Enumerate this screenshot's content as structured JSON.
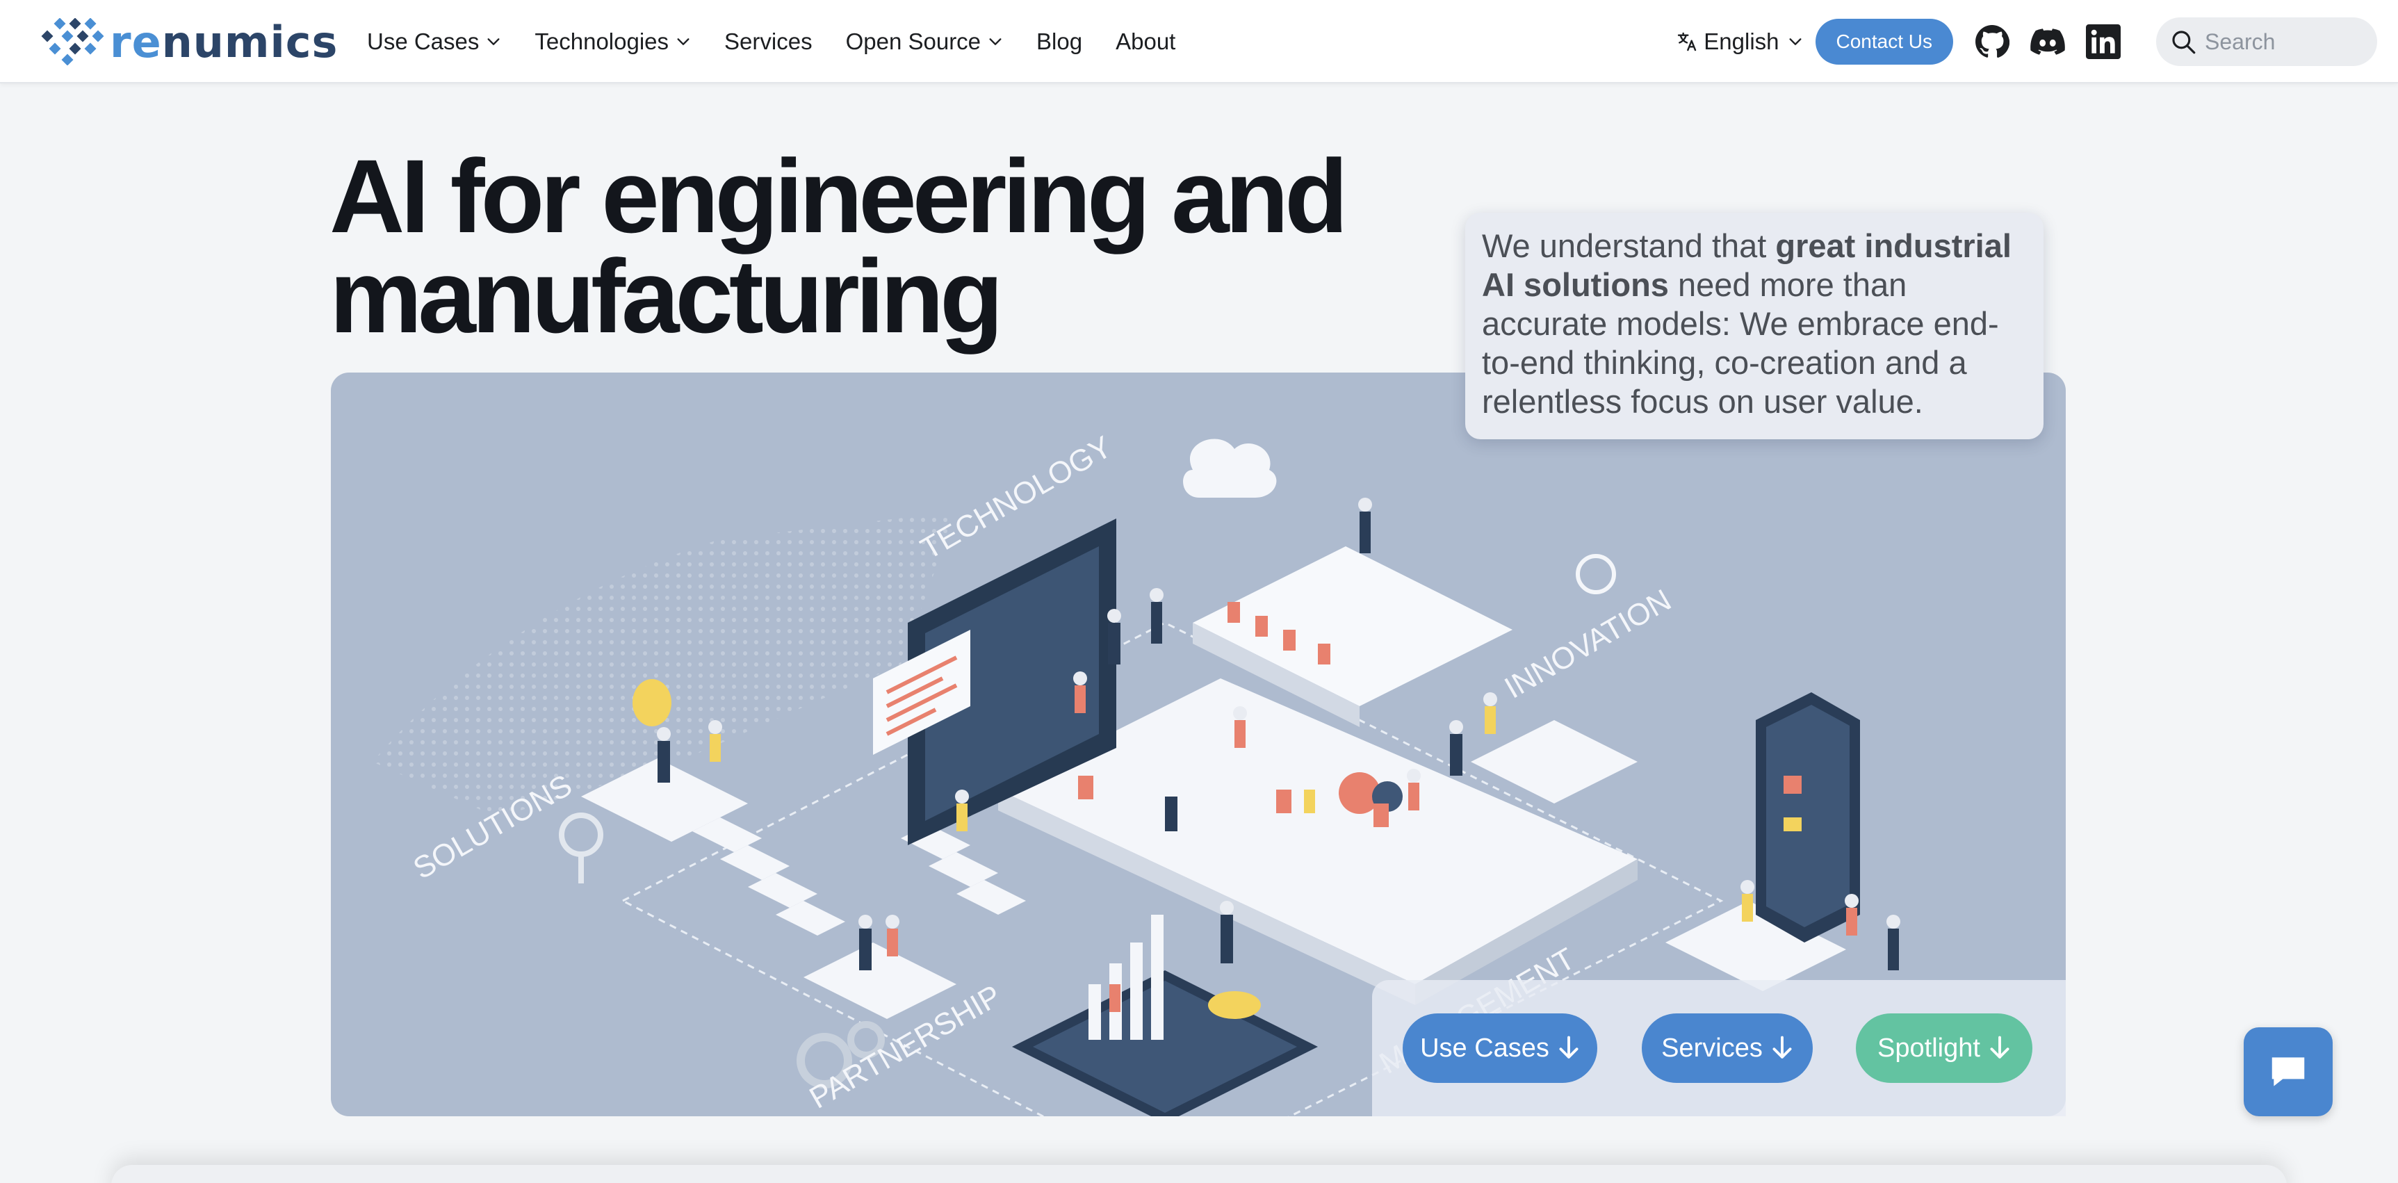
{
  "brand": {
    "name_prefix": "re",
    "name_suffix": "numics"
  },
  "nav": {
    "items": [
      {
        "label": "Use Cases",
        "dropdown": true
      },
      {
        "label": "Technologies",
        "dropdown": true
      },
      {
        "label": "Services",
        "dropdown": false
      },
      {
        "label": "Open Source",
        "dropdown": true
      },
      {
        "label": "Blog",
        "dropdown": false
      },
      {
        "label": "About",
        "dropdown": false
      }
    ],
    "language": "English",
    "contact_label": "Contact Us",
    "search_placeholder": "Search"
  },
  "hero": {
    "title_line1": "AI for engineering and",
    "title_line2": "manufacturing",
    "quote_pre": "We understand that ",
    "quote_bold": "great industrial AI solutions",
    "quote_post": " need more than accurate models: We embrace end-to-end thinking, co-creation and a relentless focus on user value.",
    "illustration_labels": {
      "technology": "TECHNOLOGY",
      "innovation": "INNOVATION",
      "solutions": "SOLUTIONS",
      "partnership": "PARTNERSHIP",
      "management": "MANAGEMENT"
    },
    "buttons": [
      {
        "label": "Use Cases"
      },
      {
        "label": "Services"
      },
      {
        "label": "Spotlight"
      }
    ]
  },
  "colors": {
    "brand_dark": "#2c4568",
    "brand_light": "#4a8fd4",
    "primary_button": "#4a86cf",
    "spotlight_button": "#63c3a1",
    "illustration_bg": "#aebbcf"
  },
  "icons": [
    "translate-icon",
    "github-icon",
    "discord-icon",
    "linkedin-icon",
    "search-icon",
    "chat-icon",
    "arrow-down-icon"
  ]
}
